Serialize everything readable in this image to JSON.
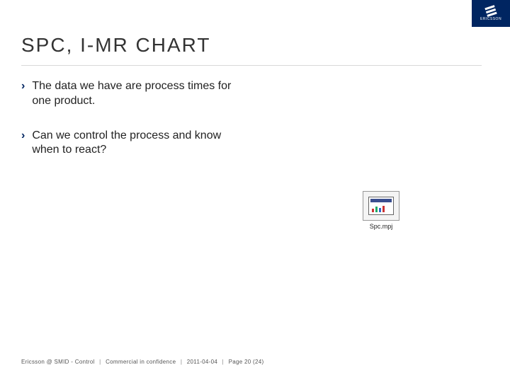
{
  "brand": {
    "name": "ERICSSON"
  },
  "title": "SPC, I-MR CHART",
  "bullets": [
    "The data we have are process times for one product.",
    "Can we control the process and know when to react?"
  ],
  "file": {
    "label": "Spc.mpj"
  },
  "footer": {
    "parts": [
      "Ericsson @ SMID - Control",
      "Commercial in confidence",
      "2011-04-04",
      "Page 20 (24)"
    ]
  }
}
